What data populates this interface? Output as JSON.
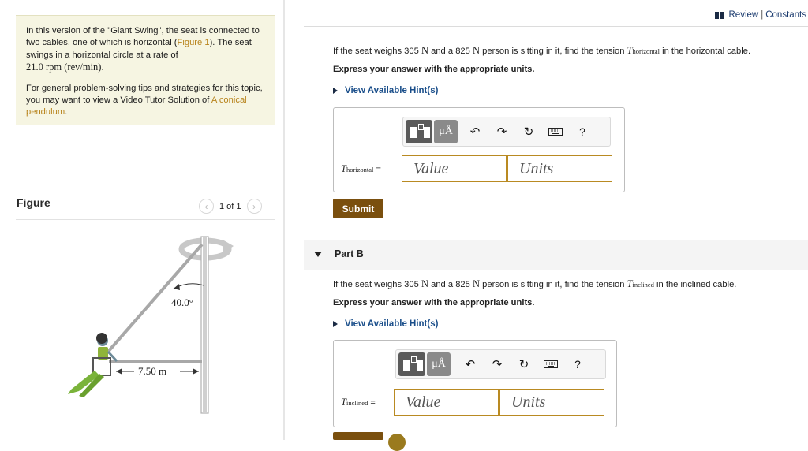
{
  "intro": {
    "p1_a": "In this version of the \"Giant Swing\", the seat is connected to two cables, one of which is horizontal (",
    "p1_link": "Figure 1",
    "p1_b": "). The seat swings in a horizontal circle at a rate of",
    "p1_rate": "21.0 rpm (rev/min)",
    "p1_end": ".",
    "p2_a": "For general problem-solving tips and strategies for this topic, you may want to view a Video Tutor Solution of ",
    "p2_link": "A conical pendulum",
    "p2_end": "."
  },
  "figure": {
    "title": "Figure",
    "pager": "1 of 1",
    "prev_icon": "chevron-left-icon",
    "next_icon": "chevron-right-icon",
    "angle_label": "40.0°",
    "length_label": "7.50 m"
  },
  "header": {
    "review": "Review",
    "separator": "|",
    "constants": "Constants",
    "icon": "book-icon"
  },
  "partA": {
    "q_pre": "If the seat weighs 305 ",
    "q_unit1": "N",
    "q_mid": " and a 825 ",
    "q_unit2": "N",
    "q_mid2": " person is sitting in it, find the tension ",
    "q_var": "T",
    "q_sub": "horizontal",
    "q_post": " in the horizontal cable.",
    "instruction": "Express your answer with the appropriate units.",
    "hint": "View Available Hint(s)",
    "var_label": "T",
    "var_sub": "horizontal",
    "var_eq": " =",
    "value_placeholder": "Value",
    "units_placeholder": "Units",
    "submit": "Submit"
  },
  "partB": {
    "label": "Part B",
    "q_pre": "If the seat weighs 305 ",
    "q_unit1": "N",
    "q_mid": " and a 825 ",
    "q_unit2": "N",
    "q_mid2": " person is sitting in it, find the tension ",
    "q_var": "T",
    "q_sub": "inclined",
    "q_post": " in the inclined cable.",
    "instruction": "Express your answer with the appropriate units.",
    "hint": "View Available Hint(s)",
    "var_label": "T",
    "var_sub": "inclined",
    "var_eq": " =",
    "value_placeholder": "Value",
    "units_placeholder": "Units"
  },
  "toolbar": {
    "mu_label": "μÅ",
    "undo_icon": "↶",
    "redo_icon": "↷",
    "reset_icon": "↻",
    "keyboard_icon": "keyboard-icon",
    "help_label": "?"
  },
  "colors": {
    "accent": "#7a4f0e",
    "link": "#b8841d",
    "hint_blue": "#1a4e8a",
    "intro_bg": "#f6f5e2"
  }
}
